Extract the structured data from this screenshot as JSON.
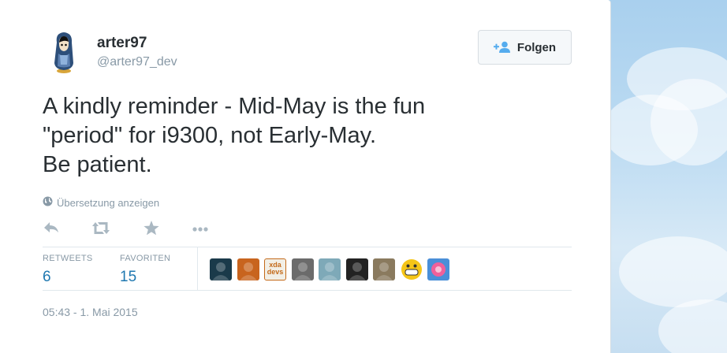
{
  "user": {
    "fullname": "arter97",
    "handle": "@arter97_dev",
    "follow_label": "Folgen"
  },
  "tweet": {
    "text": "A kindly reminder - Mid-May is the fun\n\"period\" for i9300, not Early-May.\nBe patient.",
    "translate_label": "Übersetzung anzeigen",
    "timestamp": "05:43 - 1. Mai 2015"
  },
  "actions": [
    "reply-icon",
    "retweet-icon",
    "favorite-icon",
    "more-icon"
  ],
  "stats": {
    "retweets_label": "RETWEETS",
    "retweets_count": "6",
    "favorites_label": "FAVORITEN",
    "favorites_count": "15"
  },
  "favoriters": [
    {
      "name": "favoriter-avatar-1",
      "color": "#1a3a4a"
    },
    {
      "name": "favoriter-avatar-2",
      "color": "#c8641e"
    },
    {
      "name": "favoriter-avatar-3",
      "color": "#f2efe6",
      "text": "xda devs"
    },
    {
      "name": "favoriter-avatar-4",
      "color": "#6b6b6b"
    },
    {
      "name": "favoriter-avatar-5",
      "color": "#7ea9b8"
    },
    {
      "name": "favoriter-avatar-6",
      "color": "#222222"
    },
    {
      "name": "favoriter-avatar-7",
      "color": "#8a7a5e"
    },
    {
      "name": "favoriter-avatar-8",
      "color": "#f5c518"
    },
    {
      "name": "favoriter-avatar-9",
      "color": "#4a8fd8"
    }
  ],
  "colors": {
    "text": "#292f33",
    "muted": "#8899a6",
    "link": "#1f78b0",
    "follow_icon": "#55acee"
  }
}
